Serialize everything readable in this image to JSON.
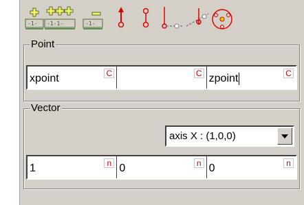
{
  "toolbar": {
    "buttons": [
      {
        "name": "add-point-button",
        "icon": "add-point-icon"
      },
      {
        "name": "add-multiple-points-button",
        "icon": "add-multiple-points-icon"
      },
      {
        "name": "remove-point-button",
        "icon": "remove-point-icon"
      },
      {
        "name": "point-red-button",
        "icon": "point-arrow-icon"
      },
      {
        "name": "point-ring-button",
        "icon": "point-ring-icon"
      },
      {
        "name": "axis-button",
        "icon": "axis-icon"
      },
      {
        "name": "axis-multi-button",
        "icon": "axis-multi-icon"
      },
      {
        "name": "circle-points-button",
        "icon": "circle-points-icon"
      }
    ]
  },
  "point": {
    "title": "Point",
    "fields": [
      {
        "value": "xpoint",
        "badge": "C"
      },
      {
        "value": "",
        "badge": "C"
      },
      {
        "value": "zpoint",
        "badge": "C"
      }
    ]
  },
  "vector": {
    "title": "Vector",
    "axis_selected": "axis X : (1,0,0)",
    "fields": [
      {
        "value": "1",
        "badge": "n"
      },
      {
        "value": "0",
        "badge": "n"
      },
      {
        "value": "0",
        "badge": "n"
      }
    ]
  },
  "colors": {
    "panel": "#d4d0c8",
    "badge": "#d60000",
    "icon_green": "#2e7d32",
    "icon_red": "#e00000"
  }
}
